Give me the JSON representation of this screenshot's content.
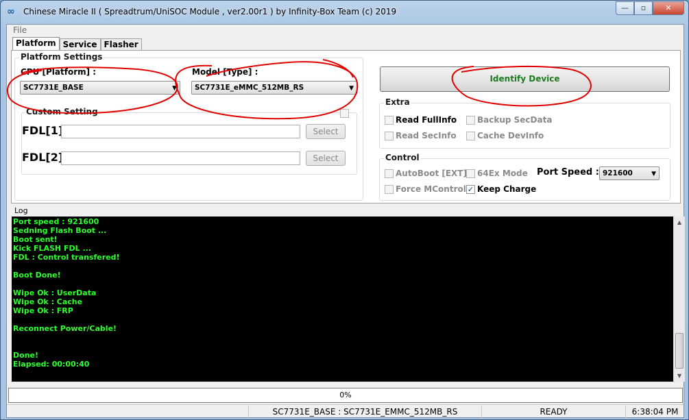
{
  "window": {
    "title": "Chinese Miracle II ( Spreadtrum/UniSOC Module , ver2.00r1  ) by Infinity-Box Team (c) 2019",
    "minimize": "—",
    "maximize": "▫",
    "close": "✕"
  },
  "menu": {
    "file": "File"
  },
  "tabs": [
    {
      "label": "Platform",
      "active": true
    },
    {
      "label": "Service",
      "active": false
    },
    {
      "label": "Flasher",
      "active": false
    }
  ],
  "platform_settings": {
    "group_label": "Platform Settings",
    "cpu_label": "CPU [Platform] :",
    "cpu_value": "SC7731E_BASE",
    "model_label": "Model [Type] :",
    "model_value": "SC7731E_eMMC_512MB_RS",
    "custom_setting_label": "Custom Setting",
    "custom_setting_checked": false,
    "fdl1_label": "FDL[1]",
    "fdl1_value": "",
    "fdl2_label": "FDL[2]",
    "fdl2_value": "",
    "select_label": "Select"
  },
  "identify_button": "Identify Device",
  "extra": {
    "group_label": "Extra",
    "read_fullinfo": {
      "label": "Read FullInfo",
      "checked": false,
      "enabled": true
    },
    "backup_secdata": {
      "label": "Backup SecData",
      "checked": false,
      "enabled": false
    },
    "read_secinfo": {
      "label": "Read SecInfo",
      "checked": false,
      "enabled": false
    },
    "cache_devinfo": {
      "label": "Cache DevInfo",
      "checked": false,
      "enabled": false
    }
  },
  "control": {
    "group_label": "Control",
    "autoboot": {
      "label": "AutoBoot [EXT]",
      "checked": false,
      "enabled": false
    },
    "ex64_mode": {
      "label": "64Ex Mode",
      "checked": false,
      "enabled": false
    },
    "force_mcontrol": {
      "label": "Force MControl",
      "checked": false,
      "enabled": false
    },
    "keep_charge": {
      "label": "Keep Charge",
      "checked": true,
      "enabled": true
    },
    "port_speed_label": "Port Speed :",
    "port_speed_value": "921600"
  },
  "log": {
    "label": "Log",
    "lines": [
      "Port speed : 921600",
      "Sedning Flash Boot ...",
      "Boot sent!",
      "Kick FLASH FDL ...",
      "FDL : Control transfered!",
      "",
      "Boot Done!",
      "",
      "Wipe Ok : UserData",
      "Wipe Ok : Cache",
      "Wipe Ok : FRP",
      "",
      "Reconnect Power/Cable!",
      "",
      "",
      "Done!",
      "Elapsed: 00:00:40"
    ],
    "text_color": "#2cff2c"
  },
  "progress": {
    "text": "0%",
    "value": 0
  },
  "status": {
    "device": "SC7731E_BASE : SC7731E_EMMC_512MB_RS",
    "state": "READY",
    "time": "6:38:04 PM"
  },
  "colors": {
    "annotation": "#e00000",
    "identify_text": "#1e7b1e"
  }
}
